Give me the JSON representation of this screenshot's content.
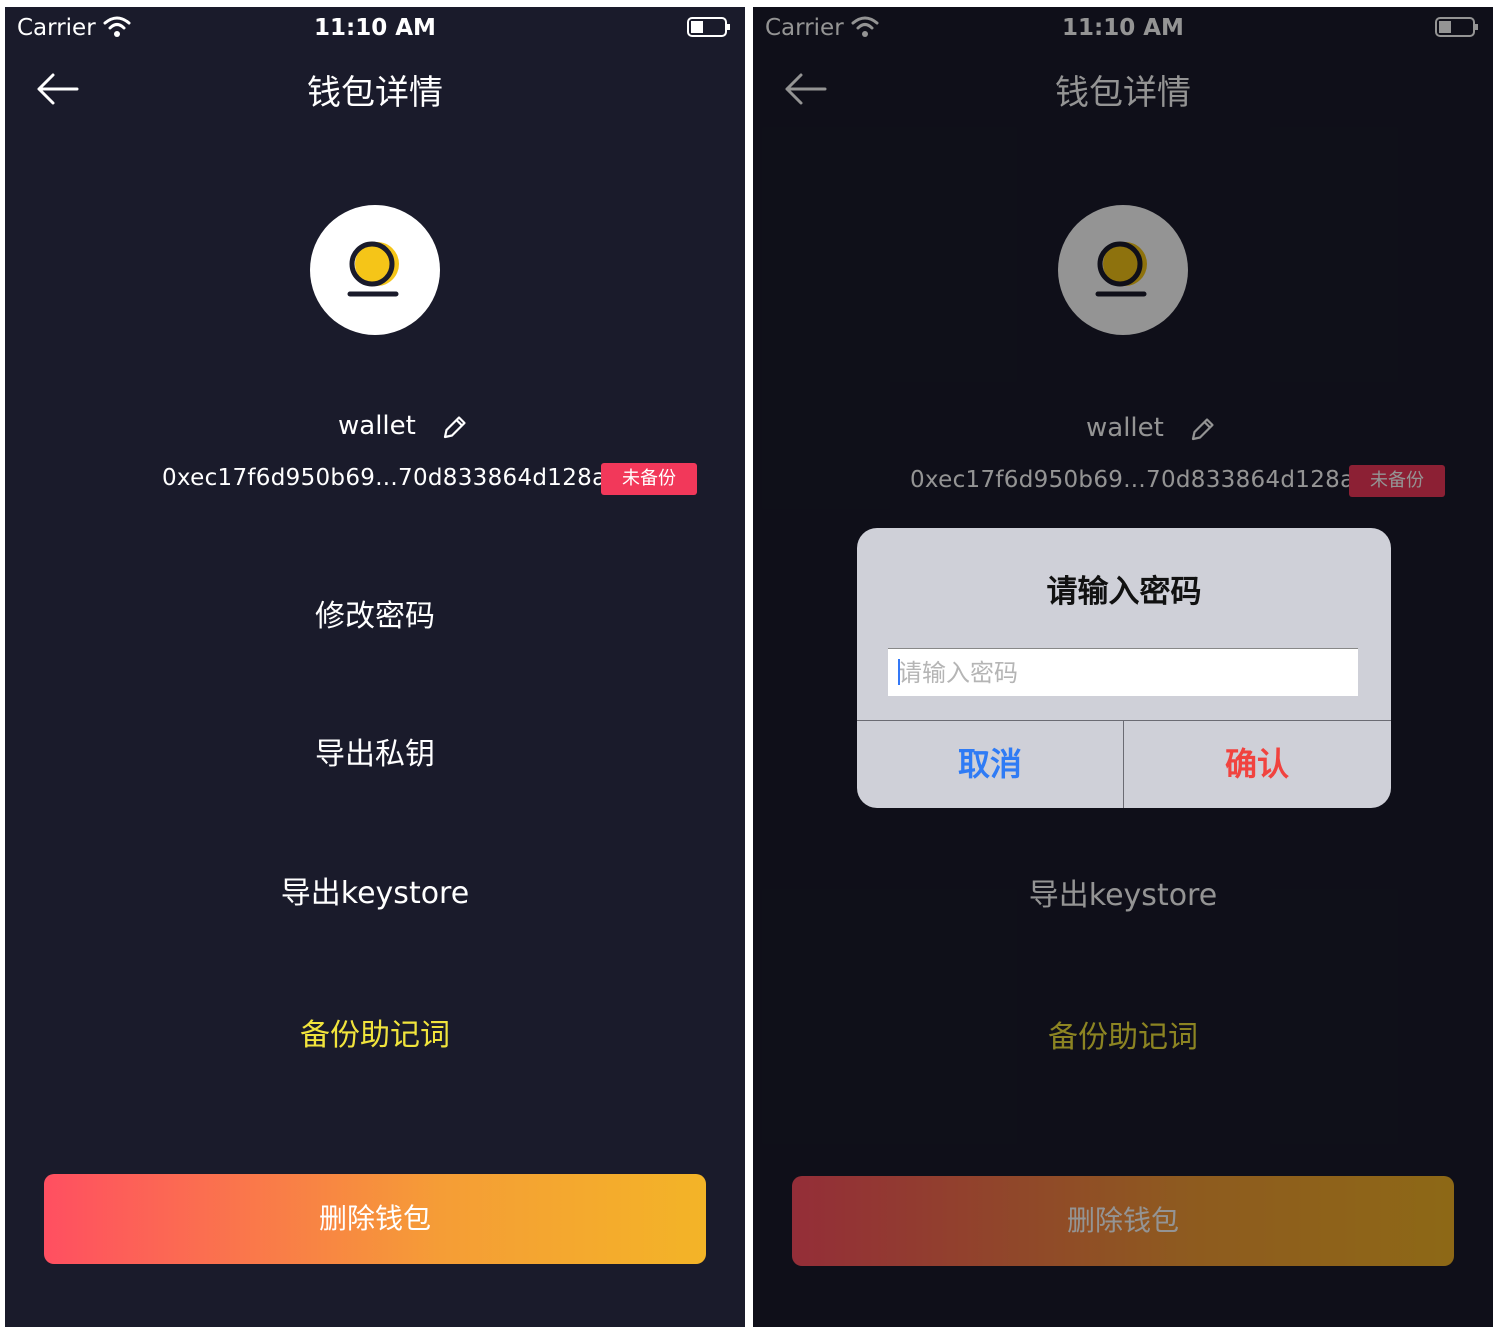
{
  "status_bar": {
    "carrier": "Carrier",
    "time": "11:10 AM"
  },
  "nav": {
    "title": "钱包详情"
  },
  "wallet": {
    "name": "wallet",
    "address": "0xec17f6d950b69...70d833864d128a",
    "backup_badge": "未备份"
  },
  "menu": {
    "change_password": "修改密码",
    "export_private_key": "导出私钥",
    "export_keystore": "导出keystore",
    "backup_mnemonic": "备份助记词"
  },
  "delete_button": "删除钱包",
  "dialog": {
    "title": "请输入密码",
    "input_placeholder": "请输入密码",
    "input_value": "",
    "cancel_label": "取消",
    "confirm_label": "确认"
  },
  "colors": {
    "background": "#1a1b2b",
    "badge": "#f2385a",
    "highlight_text": "#f1e43c",
    "cancel": "#2f7bf5",
    "confirm": "#f1433f",
    "delete_gradient_start": "#ff4f61",
    "delete_gradient_end": "#f3b427",
    "logo_yellow": "#f5c518"
  }
}
